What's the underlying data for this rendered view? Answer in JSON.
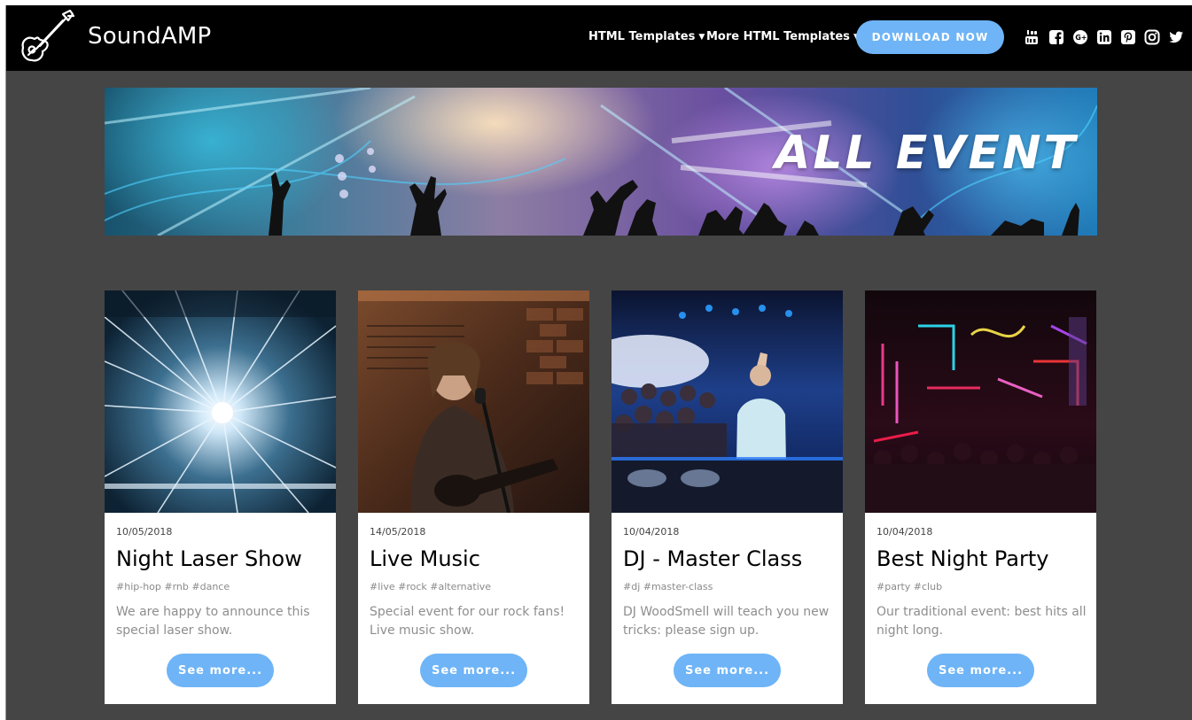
{
  "navbar": {
    "brand": "SoundAMP",
    "logo_icon": "electric-guitar-icon",
    "links": [
      {
        "label": "HTML Templates",
        "icon": "caret-down-icon"
      },
      {
        "label": "More HTML Templates",
        "icon": "caret-down-icon"
      }
    ],
    "download_label": "DOWNLOAD NOW",
    "social": [
      "youtube-icon",
      "facebook-icon",
      "google-plus-icon",
      "linkedin-icon",
      "pinterest-icon",
      "instagram-icon",
      "twitter-icon"
    ]
  },
  "banner": {
    "title": "ALL EVENT"
  },
  "events": [
    {
      "date": "10/05/2018",
      "title": "Night Laser Show",
      "tags": "#hip-hop #rnb #dance",
      "description": "We are happy to announce this special laser show.",
      "button": "See more..."
    },
    {
      "date": "14/05/2018",
      "title": "Live Music",
      "tags": "#live #rock #alternative",
      "description": "Special event for our rock fans! Live music show.",
      "button": "See more..."
    },
    {
      "date": "10/04/2018",
      "title": "DJ - Master Class",
      "tags": "#dj #master-class",
      "description": "DJ WoodSmell will teach you new tricks: please sign up.",
      "button": "See more..."
    },
    {
      "date": "10/04/2018",
      "title": "Best Night Party",
      "tags": "#party #club",
      "description": "Our traditional event: best hits all night long.",
      "button": "See more..."
    }
  ],
  "colors": {
    "accent": "#6eb4f7",
    "navbar_bg": "#000000",
    "page_bg": "#454545",
    "card_bg": "#ffffff"
  }
}
